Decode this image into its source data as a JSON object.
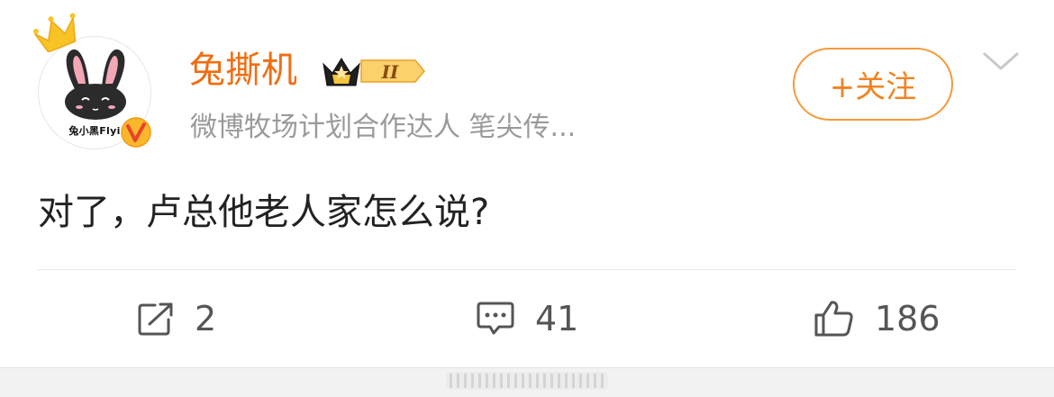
{
  "author": {
    "name": "兔撕机",
    "bio": "微博牧场计划合作达人 笔尖传...",
    "avatar_caption": "兔小黑Flyi",
    "rank_level": "II"
  },
  "follow_button": {
    "label": "+关注"
  },
  "post": {
    "text": "对了，卢总他老人家怎么说?"
  },
  "actions": {
    "repost_count": "2",
    "comment_count": "41",
    "like_count": "186"
  },
  "icons": {
    "crown": "crown-icon",
    "verified": "verified-v-icon",
    "rank": "rank-crown-badge-icon",
    "more": "chevron-down-icon",
    "repost": "share-icon",
    "comment": "comment-icon",
    "like": "thumbs-up-icon"
  },
  "colors": {
    "username": "#f26d12",
    "follow_border": "#f59a3c",
    "follow_text": "#f08422",
    "bio": "#9a9a9a",
    "text": "#222222",
    "action": "#555555"
  }
}
